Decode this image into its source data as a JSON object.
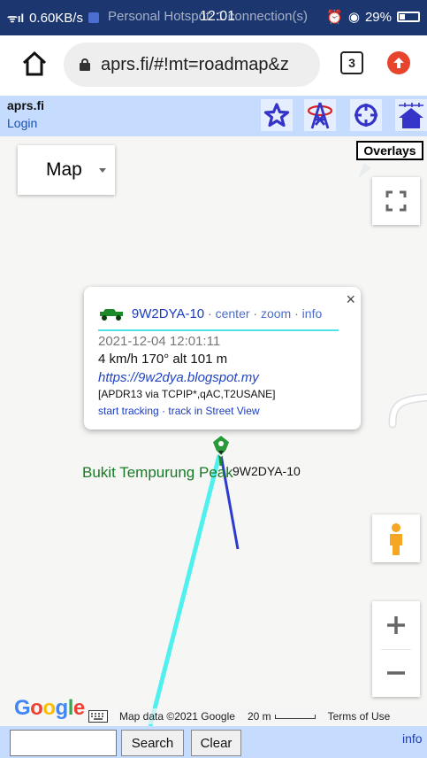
{
  "status_bar": {
    "left_text": "0.60KB/s",
    "hotspot_text": "Personal Hotspot: 1 connection(s)",
    "time": "12:01",
    "battery": "29%"
  },
  "browser": {
    "url": "aprs.fi/#!mt=roadmap&z",
    "tab_count": "3"
  },
  "header": {
    "site": "aprs.fi",
    "login": "Login"
  },
  "map": {
    "type_selector": "Map",
    "overlays_label": "Overlays",
    "place_label": "Bukit Tempurung Peak",
    "station_label": "9W2DYA-10",
    "track_colors": {
      "cyan": "#4ff0ee",
      "blue": "#2c3ccf"
    }
  },
  "infowindow": {
    "callsign": "9W2DYA-10",
    "link_center": "center",
    "link_zoom": "zoom",
    "link_info": "info",
    "sep": "·",
    "timestamp": "2021-12-04 12:01:11",
    "speed_line": "4 km/h 170° alt 101 m",
    "website": "https://9w2dya.blogspot.my",
    "path": "[APDR13 via TCPIP*,qAC,T2USANE]",
    "link_tracking": "start tracking",
    "link_streetview": "track in Street View",
    "close": "×"
  },
  "footer": {
    "google": "Google",
    "map_data": "Map data ©2021 Google",
    "scale": "20 m",
    "terms": "Terms of Use"
  },
  "bottom": {
    "search_button": "Search",
    "clear_button": "Clear",
    "info_link": "info"
  }
}
